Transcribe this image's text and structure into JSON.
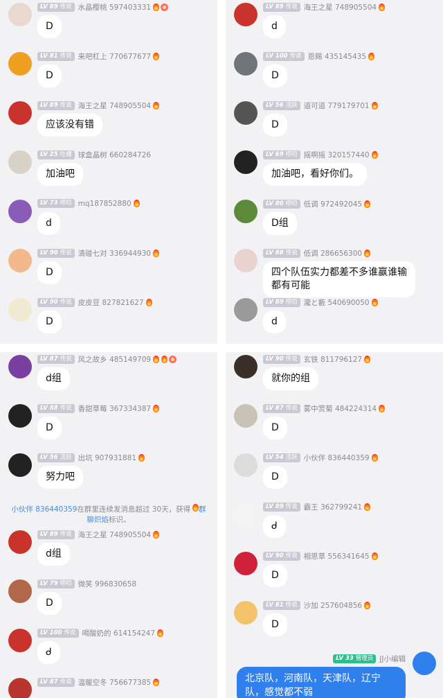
{
  "notice": {
    "pre": "在群里连续发消息超过 30天，获得",
    "user": "小伙伴 836440359",
    "badge": "群聊炽焰",
    "post": "标识。"
  },
  "panels": [
    {
      "messages": [
        {
          "lv": "LV 89",
          "title": "传说",
          "name": "水晶樱桃 597403331",
          "text": "D",
          "flames": 1,
          "medal": true,
          "avatar_color": "#e9d8cf"
        },
        {
          "lv": "LV 81",
          "title": "传说",
          "name": "来吧杠上 770677677",
          "text": "D",
          "flames": 1,
          "avatar_color": "#f0a020"
        },
        {
          "lv": "LV 89",
          "title": "传说",
          "name": "海王之星 748905504",
          "text": "应该没有错",
          "flames": 1,
          "avatar_color": "#c8342b"
        },
        {
          "lv": "LV 25",
          "title": "吐槽",
          "name": "球盒晶树 660284726",
          "text": "加油吧",
          "flames": 0,
          "avatar_color": "#d8d2c8"
        },
        {
          "lv": "LV 73",
          "title": "唠叨",
          "name": "mq187852880",
          "text": "d",
          "flames": 1,
          "avatar_color": "#8a5cb8"
        },
        {
          "lv": "LV 90",
          "title": "传说",
          "name": "清碰七对 336944930",
          "text": "D",
          "flames": 1,
          "avatar_color": "#f3b98c"
        },
        {
          "lv": "LV 90",
          "title": "传说",
          "name": "皮皮豆 827821627",
          "text": "D",
          "flames": 1,
          "avatar_color": "#f1ead2"
        }
      ]
    },
    {
      "messages": [
        {
          "lv": "LV 89",
          "title": "传说",
          "name": "海王之星 748905504",
          "text": "d",
          "flames": 1,
          "avatar_color": "#c8342b"
        },
        {
          "lv": "LV 100",
          "title": "传说",
          "name": "恩赐 435145435",
          "text": "D",
          "flames": 1,
          "avatar_color": "#6e7478"
        },
        {
          "lv": "LV 56",
          "title": "活跃",
          "name": "道可道 779179701",
          "text": "D",
          "flames": 1,
          "avatar_color": "#555555"
        },
        {
          "lv": "LV 69",
          "title": "唠叨",
          "name": "摇啊摇 320157440",
          "text": "加油吧，看好你们。",
          "flames": 1,
          "avatar_color": "#222222"
        },
        {
          "lv": "LV 80",
          "title": "唠叨",
          "name": "低调 972492045",
          "text": "D组",
          "flames": 1,
          "avatar_color": "#5a8a3a"
        },
        {
          "lv": "LV 88",
          "title": "传说",
          "name": "低调 286656300",
          "text": "四个队伍实力都差不多谁赢谁输都有可能",
          "flames": 1,
          "avatar_color": "#e8d3cf"
        },
        {
          "lv": "LV 89",
          "title": "唠叨",
          "name": "瀧と藪 540690050",
          "text": "d",
          "flames": 1,
          "avatar_color": "#9a9a9a"
        }
      ]
    },
    {
      "messages": [
        {
          "lv": "LV 87",
          "title": "传说",
          "name": "风之故乡 485149709",
          "text": "d组",
          "flames": 2,
          "medal": true,
          "avatar_color": "#7a3fa0"
        },
        {
          "lv": "LV 88",
          "title": "传说",
          "name": "香甜草莓 367334387",
          "text": "D",
          "flames": 1,
          "avatar_color": "#222222"
        },
        {
          "lv": "LV 56",
          "title": "活跃",
          "name": "出坑 907931881",
          "text": "努力吧",
          "flames": 1,
          "avatar_color": "#222222"
        },
        {
          "lv": "LV 89",
          "title": "传说",
          "name": "海王之星 748905504",
          "text": "d组",
          "flames": 1,
          "avatar_color": "#c8342b"
        },
        {
          "lv": "LV 79",
          "title": "唠叨",
          "name": "微笑 996830658",
          "text": "D",
          "flames": 0,
          "avatar_color": "#b0674a"
        },
        {
          "lv": "LV 100",
          "title": "传说",
          "name": "喝酸奶的 614154247",
          "text": "ᑯ",
          "flames": 1,
          "avatar_color": "#c8342b"
        },
        {
          "lv": "LV 87",
          "title": "传说",
          "name": "温暖空冬 756677385",
          "text": "",
          "flames": 1,
          "avatar_color": "#b8362f"
        }
      ]
    },
    {
      "messages": [
        {
          "lv": "LV 90",
          "title": "传说",
          "name": "玄铁 811796127",
          "text": "就你的组",
          "flames": 1,
          "avatar_color": "#3b2f2a"
        },
        {
          "lv": "LV 87",
          "title": "传说",
          "name": "雾中赏菊 484224314",
          "text": "D",
          "flames": 1,
          "avatar_color": "#c9c3b6"
        },
        {
          "lv": "LV 54",
          "title": "活跃",
          "name": "小伙伴 836440359",
          "text": "D",
          "flames": 1,
          "avatar_color": "#dcdcdc"
        },
        {
          "lv": "LV 89",
          "title": "传说",
          "name": "霸王 362799241",
          "text": "ᑯ",
          "flames": 1,
          "avatar_color": "#f3f3f3"
        },
        {
          "lv": "LV 90",
          "title": "传说",
          "name": "相思草 556341645",
          "text": "D",
          "flames": 1,
          "avatar_color": "#d0213a"
        },
        {
          "lv": "LV 81",
          "title": "传说",
          "name": "沙加 257604856",
          "text": "D",
          "flames": 1,
          "avatar_color": "#f2c36b"
        }
      ],
      "self": {
        "lv": "LV 33",
        "title": "管理员",
        "name": "JJ小编辑",
        "text": "北京队，河南队，天津队，辽宁队，感觉都不弱",
        "avatar_color": "#2f7fed"
      }
    }
  ]
}
